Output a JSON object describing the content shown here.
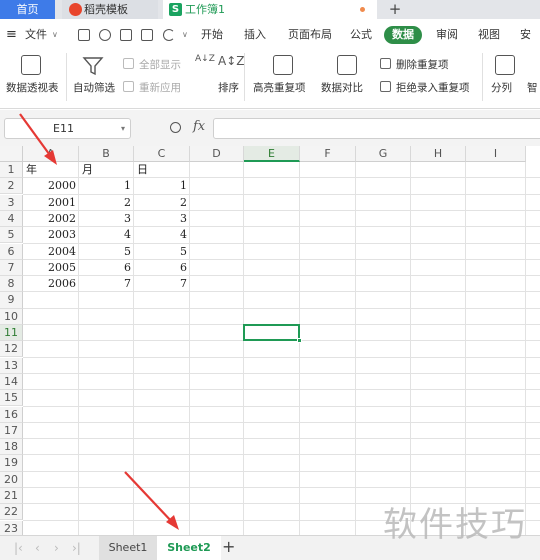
{
  "tabs": {
    "home": "首页",
    "template": "稻壳模板",
    "workbook": "工作簿1",
    "workbook_icon": "S",
    "add": "+"
  },
  "menu": {
    "file": "文件",
    "items": [
      "开始",
      "插入",
      "页面布局",
      "公式",
      "数据",
      "审阅",
      "视图",
      "安全"
    ],
    "active": "数据"
  },
  "ribbon": {
    "pivot": "数据透视表",
    "autofilter": "自动筛选",
    "show_all": "全部显示",
    "reapply": "重新应用",
    "sort": "排序",
    "highlight_dup": "高亮重复项",
    "compare": "数据对比",
    "remove_dup": "删除重复项",
    "reject_dup": "拒绝录入重复项",
    "split": "分列",
    "smart": "智"
  },
  "formula_bar": {
    "name_box": "E11",
    "fx": "fx",
    "value": ""
  },
  "columns": [
    "A",
    "B",
    "C",
    "D",
    "E",
    "F",
    "G",
    "H",
    "I"
  ],
  "selected_column": "E",
  "rows": [
    "1",
    "2",
    "3",
    "4",
    "5",
    "6",
    "7",
    "8",
    "9",
    "10",
    "11",
    "12",
    "13",
    "14",
    "15",
    "16",
    "17",
    "18",
    "19",
    "20",
    "21",
    "22",
    "23"
  ],
  "selected_row": "11",
  "table": {
    "headers": [
      "年",
      "月",
      "日"
    ],
    "data": [
      [
        "2000",
        "1",
        "1"
      ],
      [
        "2001",
        "2",
        "2"
      ],
      [
        "2002",
        "3",
        "3"
      ],
      [
        "2003",
        "4",
        "4"
      ],
      [
        "2004",
        "5",
        "5"
      ],
      [
        "2005",
        "6",
        "6"
      ],
      [
        "2006",
        "7",
        "7"
      ]
    ]
  },
  "sheets": [
    "Sheet1",
    "Sheet2"
  ],
  "active_sheet": "Sheet2",
  "watermark": "软件技巧",
  "colors": {
    "accent": "#1f9a55",
    "home_tab": "#3e7be8",
    "arrow": "#e53935"
  }
}
